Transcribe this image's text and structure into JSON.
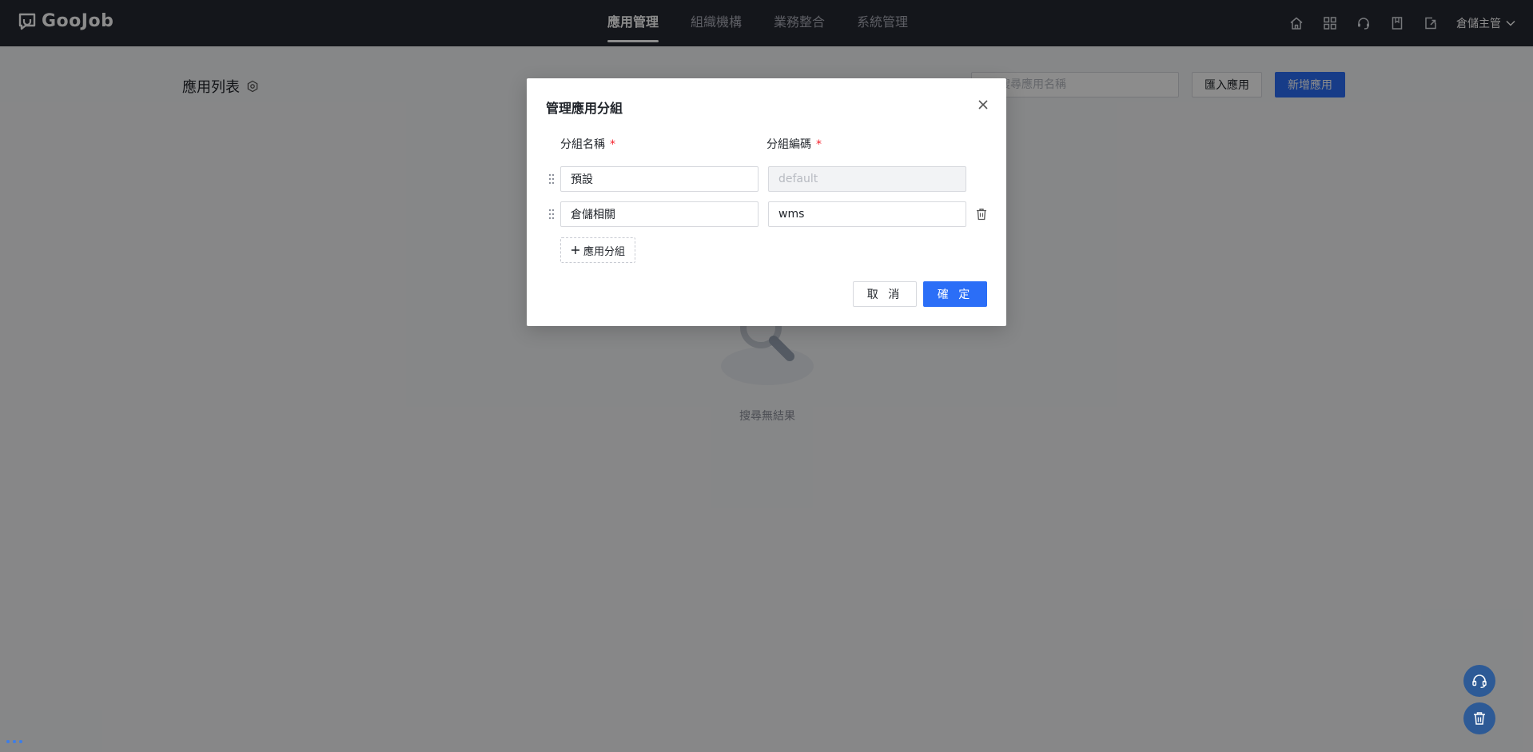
{
  "app": {
    "logo_text": "GooJob"
  },
  "nav": {
    "items": [
      {
        "label": "應用管理",
        "active": true
      },
      {
        "label": "組織機構",
        "active": false
      },
      {
        "label": "業務整合",
        "active": false
      },
      {
        "label": "系統管理",
        "active": false
      }
    ]
  },
  "topbar": {
    "icons": [
      "home-icon",
      "apps-grid-icon",
      "headset-icon",
      "bookmark-icon",
      "export-icon"
    ],
    "user_label": "倉儲主管"
  },
  "page": {
    "title": "應用列表",
    "search_placeholder": "搜尋應用名稱",
    "import_label": "匯入應用",
    "new_label": "新增應用",
    "empty_text": "搜尋無結果"
  },
  "modal": {
    "title": "管理應用分組",
    "col_name_label": "分組名稱",
    "col_code_label": "分組編碼",
    "required_mark": "*",
    "rows": [
      {
        "name": "預設",
        "code": "default",
        "code_disabled": true,
        "deletable": false
      },
      {
        "name": "倉儲相關",
        "code": "wms",
        "code_disabled": false,
        "deletable": true
      }
    ],
    "add_label": "應用分組",
    "cancel_label": "取 消",
    "confirm_label": "確 定"
  },
  "colors": {
    "topbar_bg": "#262832",
    "primary": "#2b6ef7",
    "required": "#f5222d",
    "float_btn": "#2d5a96"
  }
}
